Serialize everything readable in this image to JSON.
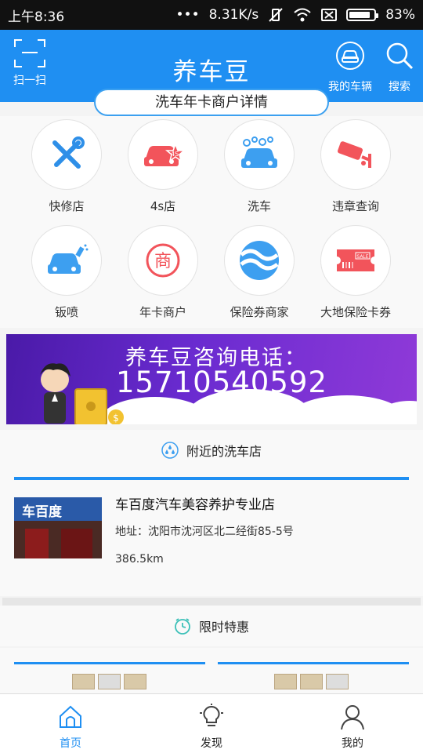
{
  "status_bar": {
    "time": "上午8:36",
    "network_speed": "8.31K/s",
    "battery": "83%"
  },
  "header": {
    "title": "养车豆",
    "scan_label": "扫一扫",
    "my_car_label": "我的车辆",
    "search_label": "搜索"
  },
  "page_pill": "洗车年卡商户详情",
  "categories": [
    {
      "label": "快修店",
      "icon": "wrench-screwdriver-icon"
    },
    {
      "label": "4s店",
      "icon": "car-4s-icon"
    },
    {
      "label": "洗车",
      "icon": "car-wash-icon"
    },
    {
      "label": "违章查询",
      "icon": "camera-icon"
    },
    {
      "label": "钣喷",
      "icon": "spray-car-icon"
    },
    {
      "label": "年卡商户",
      "icon": "shang-icon"
    },
    {
      "label": "保险券商家",
      "icon": "waves-icon"
    },
    {
      "label": "大地保险卡券",
      "icon": "sale-ticket-icon"
    }
  ],
  "banner": {
    "title": "养车豆咨询电话：",
    "phone": "15710540592"
  },
  "nearby": {
    "heading": "附近的洗车店",
    "store": {
      "name": "车百度汽车美容养护专业店",
      "address": "地址：沈阳市沈河区北二经街85-5号",
      "distance": "386.5km",
      "sign_text": "车百度"
    }
  },
  "limited": {
    "heading": "限时特惠"
  },
  "bottom_nav": [
    {
      "label": "首页",
      "icon": "home-icon",
      "active": true
    },
    {
      "label": "发现",
      "icon": "lightbulb-icon",
      "active": false
    },
    {
      "label": "我的",
      "icon": "user-icon",
      "active": false
    }
  ],
  "colors": {
    "primary": "#1f8ff2",
    "accent_red": "#f2545b",
    "accent_blue": "#3d9ff0"
  }
}
